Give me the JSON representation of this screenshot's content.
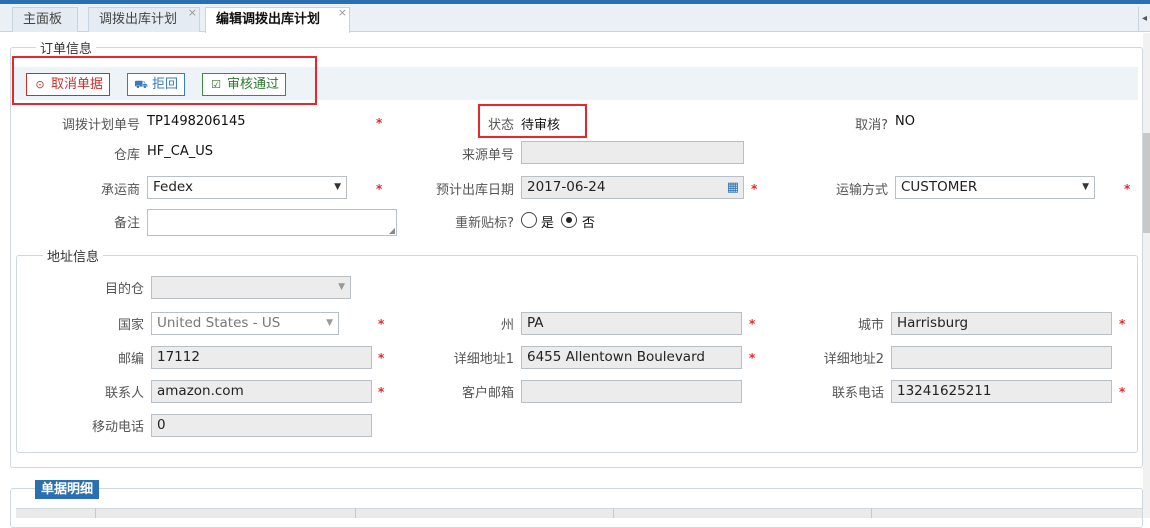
{
  "tabs": [
    {
      "label": "主面板",
      "closable": false
    },
    {
      "label": "调拨出库计划",
      "closable": true
    },
    {
      "label": "编辑调拨出库计划",
      "closable": true,
      "active": true
    }
  ],
  "close_glyph": "×",
  "tab_scroll_glyph": "◂",
  "order_info": {
    "legend": "订单信息",
    "buttons": {
      "cancel": {
        "label": "取消单据",
        "icon": "stop-circle-icon",
        "glyph": "⊙"
      },
      "reject": {
        "label": "拒回",
        "icon": "truck-icon",
        "glyph": "⛟"
      },
      "approve": {
        "label": "审核通过",
        "icon": "checkbox-check-icon",
        "glyph": "☑"
      }
    },
    "plan_no": {
      "label": "调拨计划单号",
      "value": "TP1498206145"
    },
    "status": {
      "label": "状态",
      "value": "待审核"
    },
    "cancelled": {
      "label": "取消?",
      "value": "NO"
    },
    "warehouse": {
      "label": "仓库",
      "value": "HF_CA_US"
    },
    "source_no": {
      "label": "来源单号",
      "value": ""
    },
    "carrier": {
      "label": "承运商",
      "value": "Fedex"
    },
    "planned_date": {
      "label": "预计出库日期",
      "value": "2017-06-24"
    },
    "ship_method": {
      "label": "运输方式",
      "value": "CUSTOMER"
    },
    "remark": {
      "label": "备注",
      "value": ""
    },
    "relabel": {
      "label": "重新贴标?",
      "options": [
        "是",
        "否"
      ],
      "selected": "否"
    }
  },
  "address_info": {
    "legend": "地址信息",
    "dest_warehouse": {
      "label": "目的仓",
      "value": ""
    },
    "country": {
      "label": "国家",
      "value": "United States - US"
    },
    "state": {
      "label": "州",
      "value": "PA"
    },
    "city": {
      "label": "城市",
      "value": "Harrisburg"
    },
    "zip": {
      "label": "邮编",
      "value": "17112"
    },
    "address1": {
      "label": "详细地址1",
      "value": "6455 Allentown Boulevard"
    },
    "address2": {
      "label": "详细地址2",
      "value": ""
    },
    "contact": {
      "label": "联系人",
      "value": "amazon.com"
    },
    "email": {
      "label": "客户邮箱",
      "value": ""
    },
    "phone": {
      "label": "联系电话",
      "value": "13241625211"
    },
    "mobile": {
      "label": "移动电话",
      "value": "0"
    }
  },
  "details": {
    "tag": "单据明细"
  },
  "required_mark": "*",
  "caret_glyph": "▼",
  "calendar_glyph": "▦",
  "resize_glyph": "◢",
  "colors": {
    "accent": "#2a6fb0",
    "danger": "#c9302c",
    "success": "#2d7a2d",
    "highlight": "#e8262b"
  }
}
